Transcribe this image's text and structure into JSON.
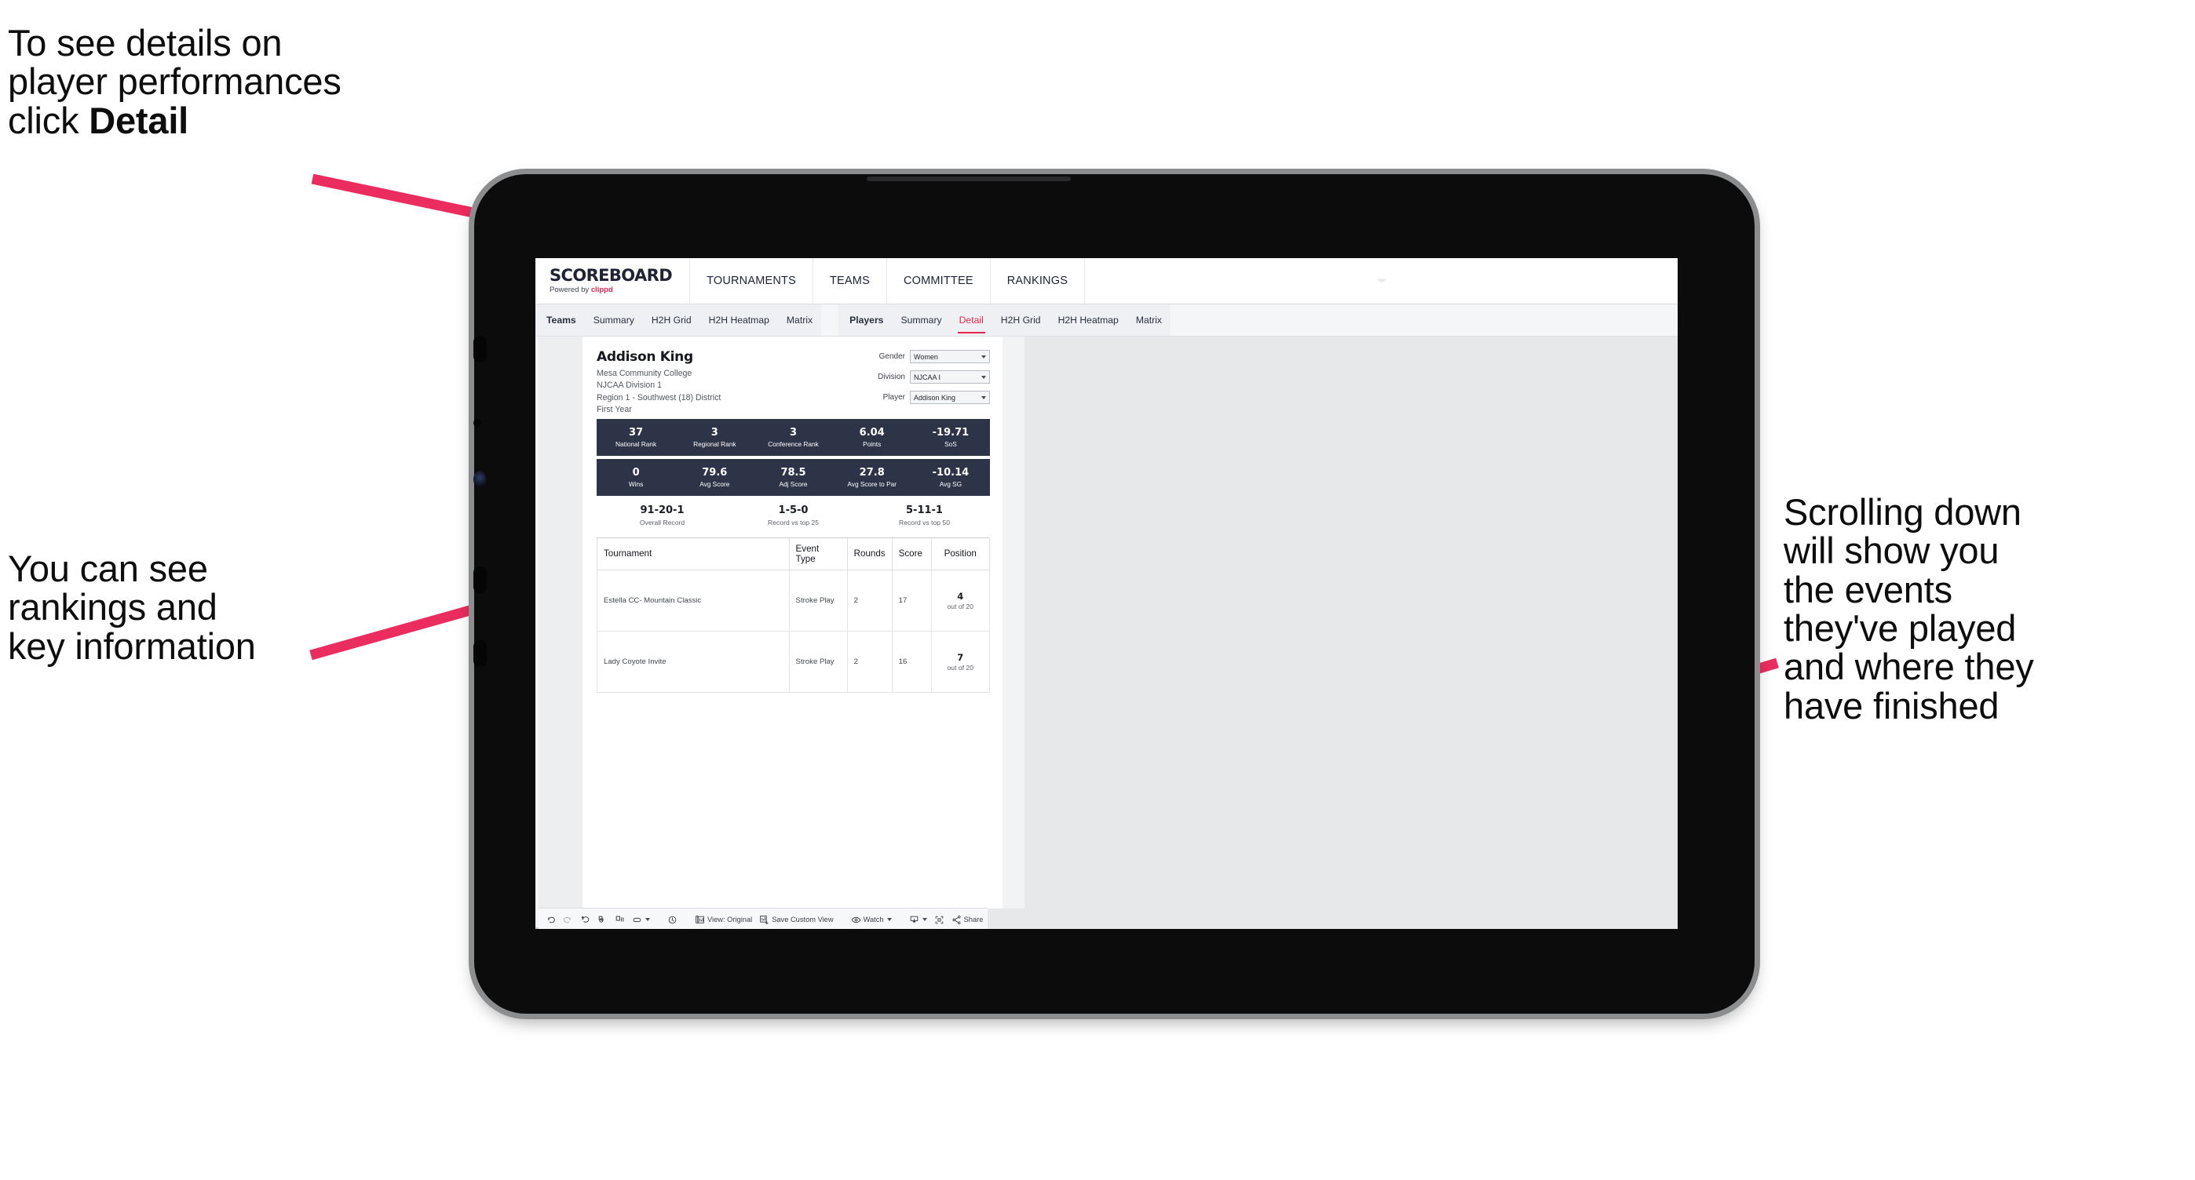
{
  "annotations": {
    "top_left": "To see details on\nplayer performances\nclick ",
    "top_left_bold": "Detail",
    "mid_left": "You can see\nrankings and\nkey information",
    "right": "Scrolling down\nwill show you\nthe events\nthey've played\nand where they\nhave finished",
    "arrow_color": "#ea2d5e"
  },
  "app": {
    "brand": {
      "title": "SCOREBOARD",
      "powered_prefix": "Powered by ",
      "powered_name": "clippd"
    },
    "topnav": [
      {
        "label": "TOURNAMENTS"
      },
      {
        "label": "TEAMS"
      },
      {
        "label": "COMMITTEE"
      },
      {
        "label": "RANKINGS"
      }
    ],
    "subnav": {
      "teams_group_label": "Teams",
      "teams_items": [
        "Summary",
        "H2H Grid",
        "H2H Heatmap",
        "Matrix"
      ],
      "players_group_label": "Players",
      "players_items": [
        "Summary",
        "Detail",
        "H2H Grid",
        "H2H Heatmap",
        "Matrix"
      ],
      "active_item": "Detail"
    }
  },
  "player": {
    "name": "Addison King",
    "college": "Mesa Community College",
    "division": "NJCAA Division 1",
    "region": "Region 1 - Southwest (18) District",
    "year": "First Year"
  },
  "selectors": [
    {
      "label": "Gender",
      "value": "Women"
    },
    {
      "label": "Division",
      "value": "NJCAA I"
    },
    {
      "label": "Player",
      "value": "Addison King"
    }
  ],
  "stats_row1": [
    {
      "value": "37",
      "label": "National Rank"
    },
    {
      "value": "3",
      "label": "Regional Rank"
    },
    {
      "value": "3",
      "label": "Conference Rank"
    },
    {
      "value": "6.04",
      "label": "Points"
    },
    {
      "value": "-19.71",
      "label": "SoS"
    }
  ],
  "stats_row2": [
    {
      "value": "0",
      "label": "Wins"
    },
    {
      "value": "79.6",
      "label": "Avg Score"
    },
    {
      "value": "78.5",
      "label": "Adj Score"
    },
    {
      "value": "27.8",
      "label": "Avg Score to Par"
    },
    {
      "value": "-10.14",
      "label": "Avg SG"
    }
  ],
  "records": [
    {
      "value": "91-20-1",
      "label": "Overall Record"
    },
    {
      "value": "1-5-0",
      "label": "Record vs top 25"
    },
    {
      "value": "5-11-1",
      "label": "Record vs top 50"
    }
  ],
  "tournament_table": {
    "headers": [
      "Tournament",
      "Event Type",
      "Rounds",
      "Score",
      "Position"
    ],
    "rows": [
      {
        "tournament": "Estella CC- Mountain Classic",
        "event_type": "Stroke Play",
        "rounds": "2",
        "score": "17",
        "position_num": "4",
        "position_of": "out of 20"
      },
      {
        "tournament": "Lady Coyote Invite",
        "event_type": "Stroke Play",
        "rounds": "2",
        "score": "16",
        "position_num": "7",
        "position_of": "out of 20"
      }
    ]
  },
  "toolbar": {
    "view_label": "View: Original",
    "save_label": "Save Custom View",
    "watch_label": "Watch",
    "share_label": "Share",
    "icons": [
      "undo-icon",
      "redo-icon",
      "revert-icon",
      "refresh-icon",
      "pause-icon",
      "loop-icon",
      "dropdown-caret-icon",
      "clock-icon",
      "view-original-icon",
      "save-custom-view-icon",
      "eye-icon",
      "download-icon",
      "fullscreen-icon",
      "share-icon"
    ]
  },
  "colors": {
    "accent_pink": "#e8264d",
    "stat_panel": "#2e3448",
    "app_bg": "#e6e8ea"
  }
}
